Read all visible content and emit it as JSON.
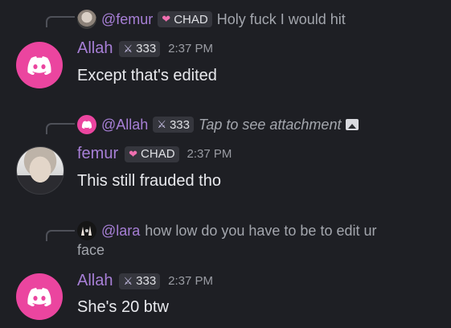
{
  "messages": [
    {
      "reply": {
        "name": "@femur",
        "badge_text": "CHAD",
        "badge_icon": "heart-icon",
        "text": "Holy fuck I would hit"
      },
      "author": "Allah",
      "author_badge_text": "333",
      "author_badge_icon": "sword-icon",
      "time": "2:37 PM",
      "content": "Except that's edited"
    },
    {
      "reply": {
        "name": "@Allah",
        "badge_text": "333",
        "badge_icon": "sword-icon",
        "text": "Tap to see attachment"
      },
      "author": "femur",
      "author_badge_text": "CHAD",
      "author_badge_icon": "heart-icon",
      "time": "2:37 PM",
      "content": "This still frauded tho"
    },
    {
      "reply": {
        "name": "@lara",
        "text_line1": "how low do you have to be to edit ur",
        "text_line2": "face"
      },
      "author": "Allah",
      "author_badge_text": "333",
      "author_badge_icon": "sword-icon",
      "time": "2:37 PM",
      "content": "She's 20 btw"
    }
  ],
  "colors": {
    "background": "#1e1f24",
    "username": "#a77fd6",
    "discord_pink": "#eb459f",
    "badge_bg": "#35363d"
  }
}
